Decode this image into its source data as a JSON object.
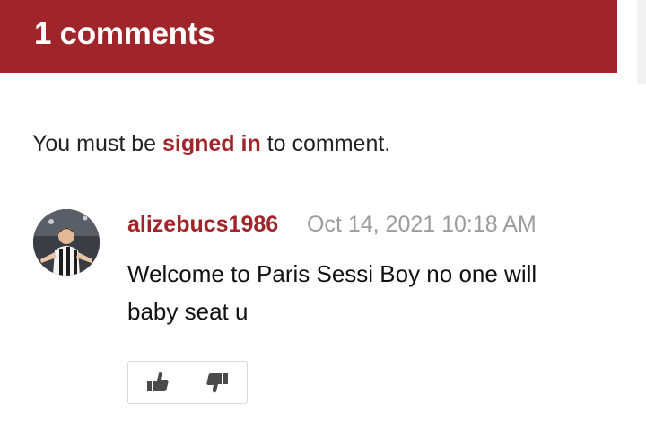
{
  "header": {
    "title": "1 comments",
    "background_color": "#a0252a"
  },
  "signin_prompt": {
    "prefix": "You must be ",
    "link_text": "signed in",
    "suffix": " to comment."
  },
  "comments": [
    {
      "avatar_icon": "user-avatar-photo",
      "username": "alizebucs1986",
      "timestamp": "Oct 14, 2021 10:18 AM",
      "text": "Welcome to Paris Sessi Boy no one will baby seat u",
      "actions": {
        "upvote_icon": "thumbs-up-icon",
        "downvote_icon": "thumbs-down-icon"
      }
    }
  ],
  "colors": {
    "accent": "#a0252a",
    "muted_text": "#9c9c9c",
    "body_text": "#111111"
  }
}
